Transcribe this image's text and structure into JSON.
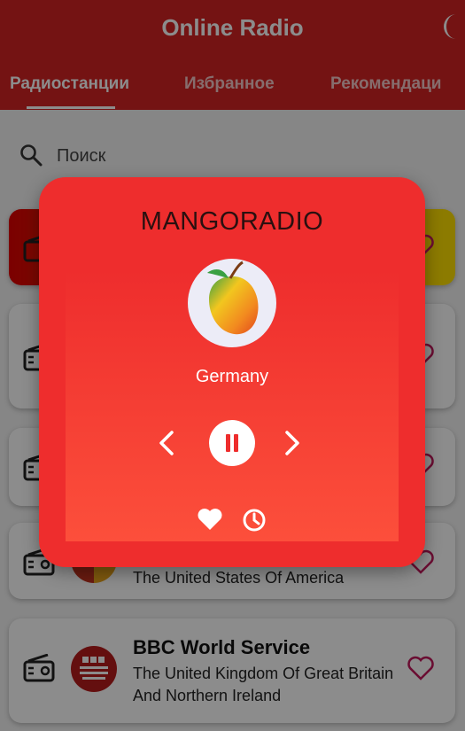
{
  "app": {
    "title": "Online Radio",
    "accent_color": "#d42323",
    "theme_icon": "moon-icon"
  },
  "tabs": [
    {
      "label": "Радиостанции",
      "active": true
    },
    {
      "label": "Избранное",
      "active": false
    },
    {
      "label": "Рекомендаци",
      "active": false
    }
  ],
  "search": {
    "icon": "search-icon",
    "placeholder": "Поиск"
  },
  "stations": [
    {
      "name": "",
      "country": ""
    },
    {
      "name": "",
      "country": ""
    },
    {
      "name": "",
      "country": ""
    },
    {
      "name": "",
      "country": "The United States Of America"
    },
    {
      "name": "BBC World Service",
      "country": "The United Kingdom Of Great Britain And Northern Ireland"
    }
  ],
  "player": {
    "station_name": "MANGORADIO",
    "country": "Germany",
    "state": "playing",
    "icons": {
      "prev": "chevron-left-icon",
      "play_pause": "pause-icon",
      "next": "chevron-right-icon",
      "favorite": "heart-filled-icon",
      "history": "clock-icon"
    }
  }
}
